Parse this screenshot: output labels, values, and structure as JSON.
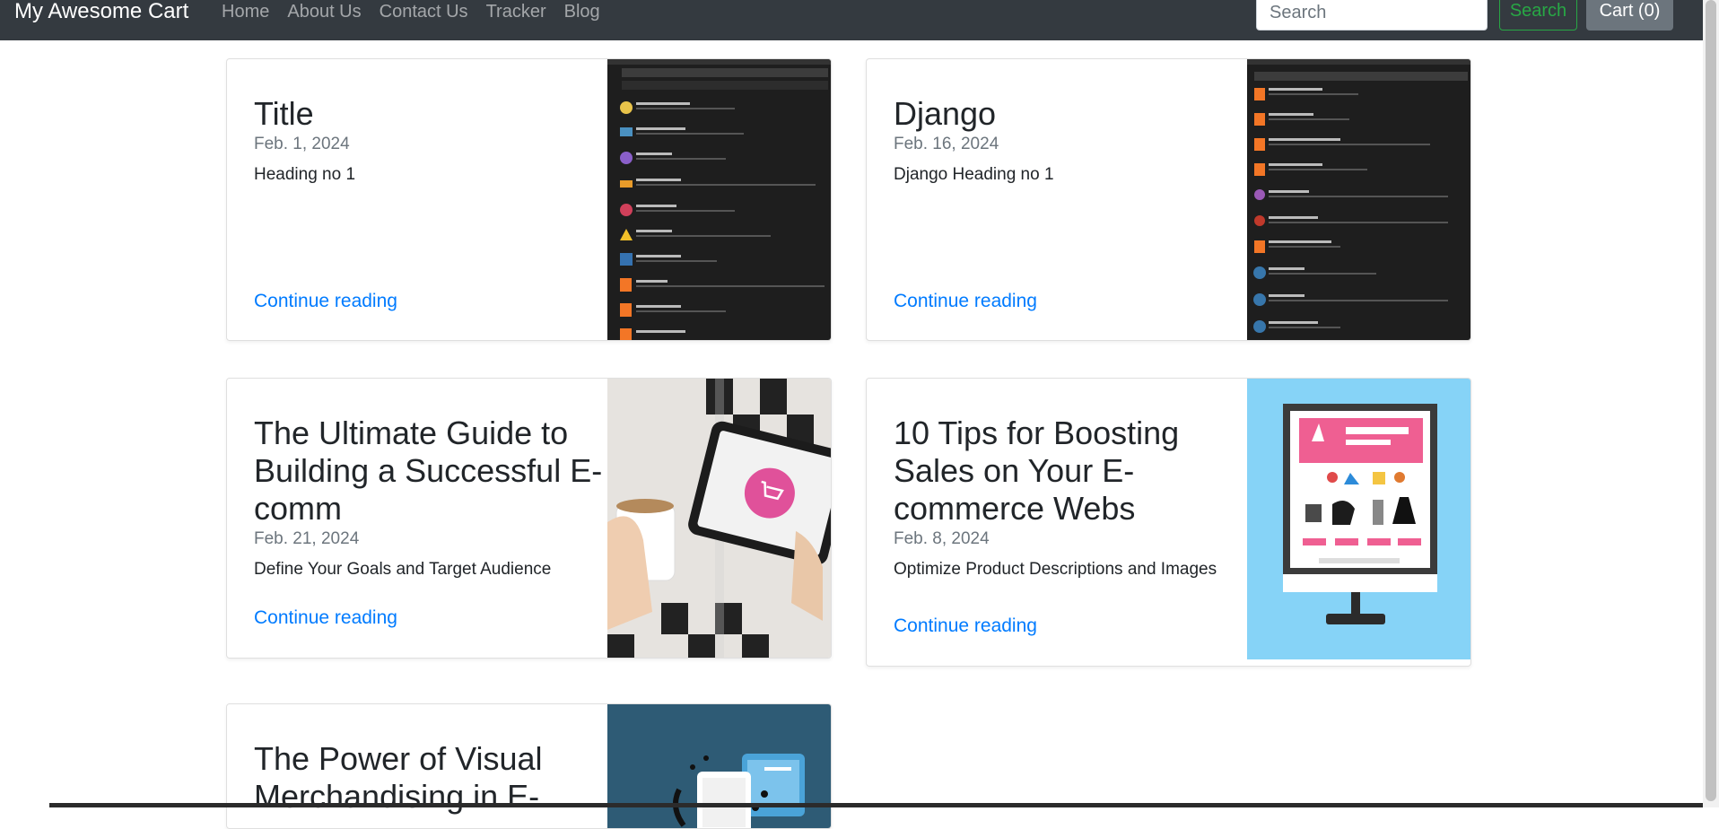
{
  "navbar": {
    "brand": "My Awesome Cart",
    "links": [
      "Home",
      "About Us",
      "Contact Us",
      "Tracker",
      "Blog"
    ],
    "search_placeholder": "Search",
    "search_button": "Search",
    "cart_button": "Cart (0)"
  },
  "posts": [
    {
      "title": "Title",
      "date": "Feb. 1, 2024",
      "heading": "Heading no 1",
      "link": "Continue reading",
      "image": "vscode-extensions-screenshot"
    },
    {
      "title": "Django",
      "date": "Feb. 16, 2024",
      "heading": "Django Heading no 1",
      "link": "Continue reading",
      "image": "vscode-python-extensions-screenshot"
    },
    {
      "title": "The Ultimate Guide to Building a Successful E-comm",
      "date": "Feb. 21, 2024",
      "heading": "Define Your Goals and Target Audience",
      "link": "Continue reading",
      "image": "tablet-shopping-cart-photo"
    },
    {
      "title": "10 Tips for Boosting Sales on Your E-commerce Webs",
      "date": "Feb. 8, 2024",
      "heading": "Optimize Product Descriptions and Images",
      "link": "Continue reading",
      "image": "ecommerce-monitor-illustration"
    },
    {
      "title": "The Power of Visual Merchandising in E-",
      "image": "mobile-shopping-illustration"
    }
  ],
  "colors": {
    "navbar": "#343a40",
    "link": "#007bff",
    "search_button": "#28a745",
    "cart_button": "#6c757d"
  }
}
